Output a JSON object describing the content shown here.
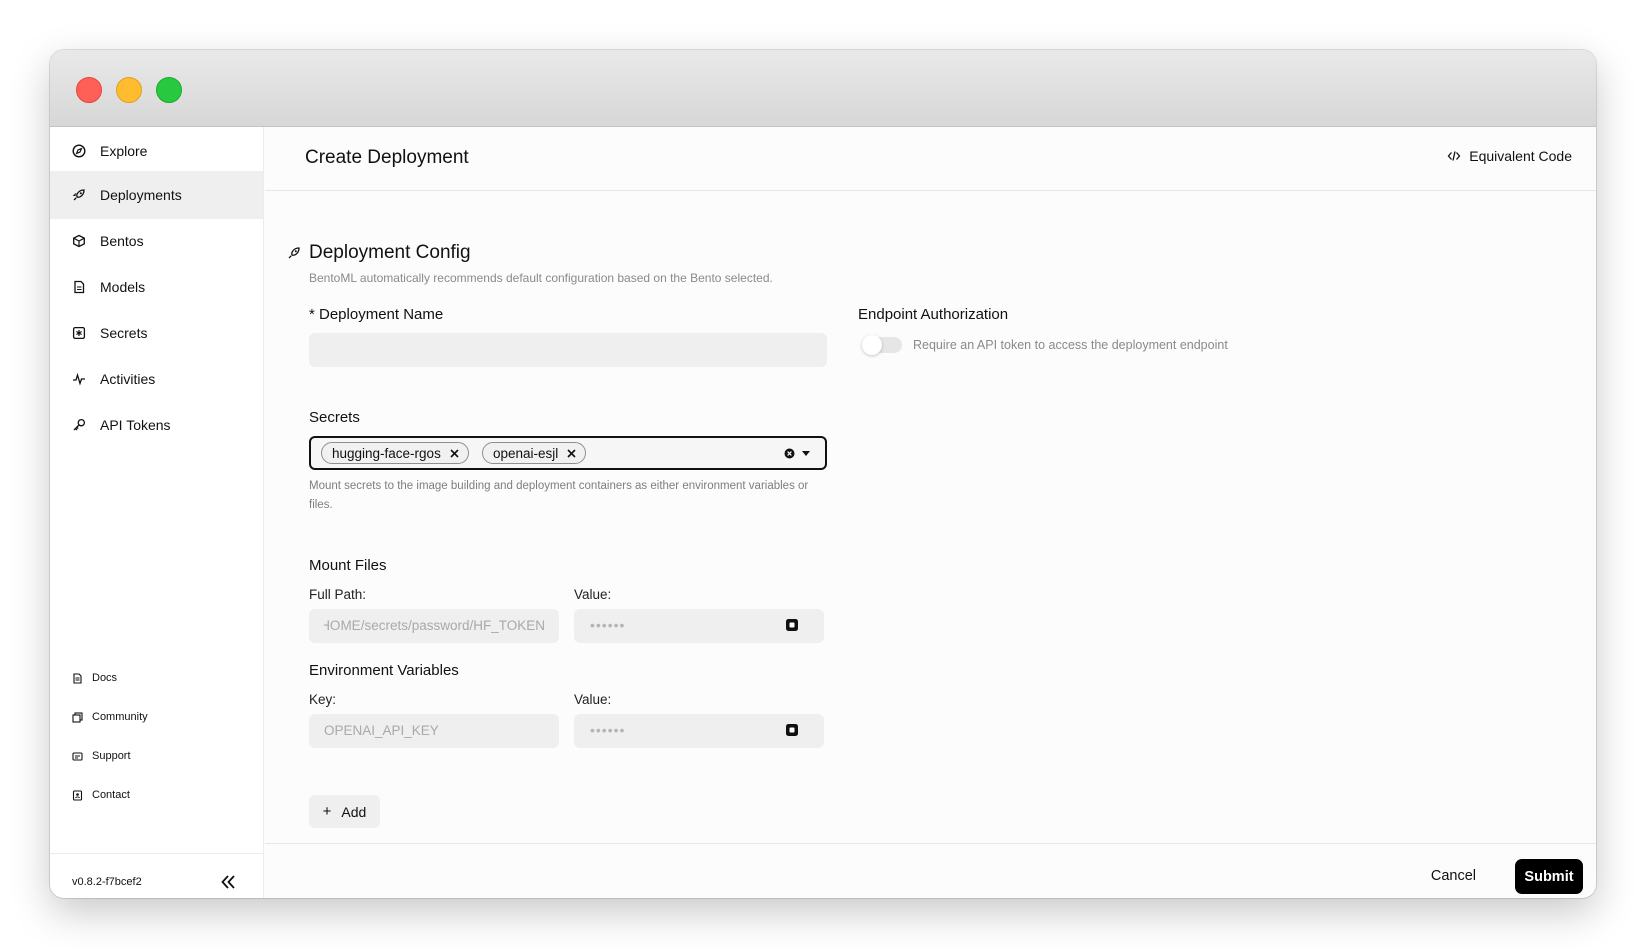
{
  "sidebar": {
    "items": [
      {
        "label": "Explore",
        "icon": "compass-icon"
      },
      {
        "label": "Deployments",
        "icon": "rocket-icon",
        "active": true
      },
      {
        "label": "Bentos",
        "icon": "box-icon"
      },
      {
        "label": "Models",
        "icon": "file-icon"
      },
      {
        "label": "Secrets",
        "icon": "secret-icon"
      },
      {
        "label": "Activities",
        "icon": "activity-icon"
      },
      {
        "label": "API Tokens",
        "icon": "key-icon"
      }
    ],
    "footer_links": [
      {
        "label": "Docs",
        "icon": "doc-icon"
      },
      {
        "label": "Community",
        "icon": "community-icon"
      },
      {
        "label": "Support",
        "icon": "support-icon"
      },
      {
        "label": "Contact",
        "icon": "contact-icon"
      }
    ],
    "version": "v0.8.2-f7bcef2"
  },
  "header": {
    "title": "Create Deployment",
    "equivalent_code_label": "Equivalent Code"
  },
  "config": {
    "title": "Deployment Config",
    "description": "BentoML automatically recommends default configuration based on the Bento selected.",
    "deployment_name_label": "* Deployment Name",
    "deployment_name_value": "",
    "endpoint_auth_label": "Endpoint Authorization",
    "endpoint_auth_text": "Require an API token to access the deployment endpoint",
    "endpoint_auth_enabled": false,
    "secrets_label": "Secrets",
    "secrets_selected": [
      "hugging-face-rgos",
      "openai-esjl"
    ],
    "secrets_help": "Mount secrets to the image building and deployment containers as either environment variables or files.",
    "mount_files_label": "Mount Files",
    "full_path_label": "Full Path:",
    "full_path_value": "HOME/secrets/password/HF_TOKEN",
    "mount_value_label": "Value:",
    "mount_value_mask": "••••••",
    "env_vars_label": "Environment Variables",
    "key_label": "Key:",
    "key_value": "OPENAI_API_KEY",
    "env_value_label": "Value:",
    "env_value_mask": "••••••",
    "add_label": "Add"
  },
  "footer": {
    "cancel_label": "Cancel",
    "submit_label": "Submit"
  },
  "colors": {
    "active_nav_bg": "#efefef",
    "primary_button": "#000000",
    "traffic_red": "#fe5f57",
    "traffic_yellow": "#febc2e",
    "traffic_green": "#28c840"
  }
}
